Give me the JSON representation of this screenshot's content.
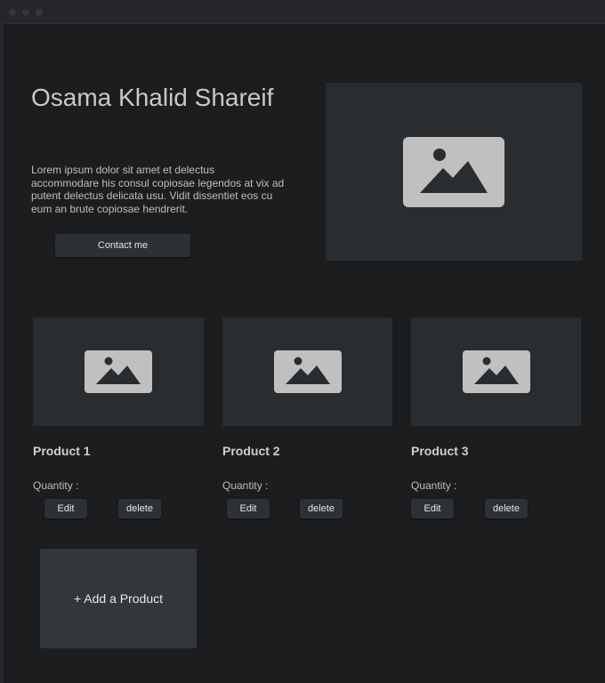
{
  "hero": {
    "name": "Osama Khalid Shareif",
    "description": "Lorem ipsum dolor sit amet et delectus accommodare his consul copiosae legendos at vix ad putent delectus delicata usu. Vidit dissentiet eos cu eum an brute copiosae hendrerit.",
    "contact_label": "Contact me",
    "image_icon": "image-placeholder-icon"
  },
  "products": [
    {
      "title": "Product 1",
      "quantity_label": "Quantity :",
      "edit_label": "Edit",
      "delete_label": "delete"
    },
    {
      "title": "Product 2",
      "quantity_label": "Quantity :",
      "edit_label": "Edit",
      "delete_label": "delete"
    },
    {
      "title": "Product 3",
      "quantity_label": "Quantity :",
      "edit_label": "Edit",
      "delete_label": "delete"
    }
  ],
  "add_product_label": "+ Add a Product",
  "colors": {
    "background": "#1c1d1f",
    "panel": "#2a2d30",
    "button": "#2d3034",
    "placeholder_icon": "#c0c0c0"
  }
}
